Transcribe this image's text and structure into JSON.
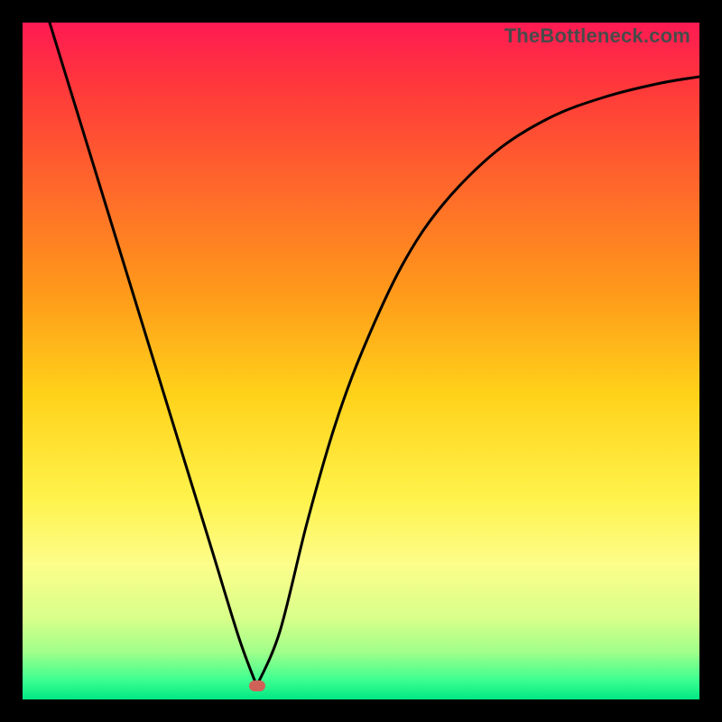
{
  "watermark": "TheBottleneck.com",
  "colors": {
    "frame": "#000000",
    "curve": "#000000",
    "marker": "#d06158",
    "gradient_stops": [
      {
        "offset": 0.0,
        "color": "#ff1a52"
      },
      {
        "offset": 0.1,
        "color": "#ff3a3a"
      },
      {
        "offset": 0.25,
        "color": "#ff6a2a"
      },
      {
        "offset": 0.4,
        "color": "#ff9a1a"
      },
      {
        "offset": 0.55,
        "color": "#ffd21a"
      },
      {
        "offset": 0.7,
        "color": "#fff24a"
      },
      {
        "offset": 0.8,
        "color": "#fdfd8a"
      },
      {
        "offset": 0.88,
        "color": "#d8ff8a"
      },
      {
        "offset": 0.93,
        "color": "#a0ff8a"
      },
      {
        "offset": 0.97,
        "color": "#40ff90"
      },
      {
        "offset": 1.0,
        "color": "#00e884"
      }
    ]
  },
  "chart_data": {
    "type": "line",
    "title": "",
    "xlabel": "",
    "ylabel": "",
    "xlim": [
      0,
      1
    ],
    "ylim": [
      0,
      1
    ],
    "note": "Axes are unlabeled; values are normalized fractions of the plot area. y increases upward (1 = top, 0 = bottom). The curve is a single continuous V-shaped trace with a cusp/minimum at the marker.",
    "series": [
      {
        "name": "bottleneck-curve",
        "x": [
          0.04,
          0.08,
          0.12,
          0.16,
          0.2,
          0.24,
          0.28,
          0.32,
          0.346,
          0.38,
          0.42,
          0.46,
          0.5,
          0.56,
          0.62,
          0.7,
          0.78,
          0.86,
          0.94,
          1.0
        ],
        "y": [
          1.0,
          0.87,
          0.74,
          0.61,
          0.48,
          0.35,
          0.22,
          0.09,
          0.02,
          0.1,
          0.26,
          0.4,
          0.51,
          0.64,
          0.73,
          0.81,
          0.86,
          0.89,
          0.91,
          0.92
        ]
      }
    ],
    "marker": {
      "x": 0.346,
      "y": 0.02
    },
    "gradient_axis": "vertical",
    "gradient_meaning": "top = bad (red), bottom = good (green)"
  }
}
